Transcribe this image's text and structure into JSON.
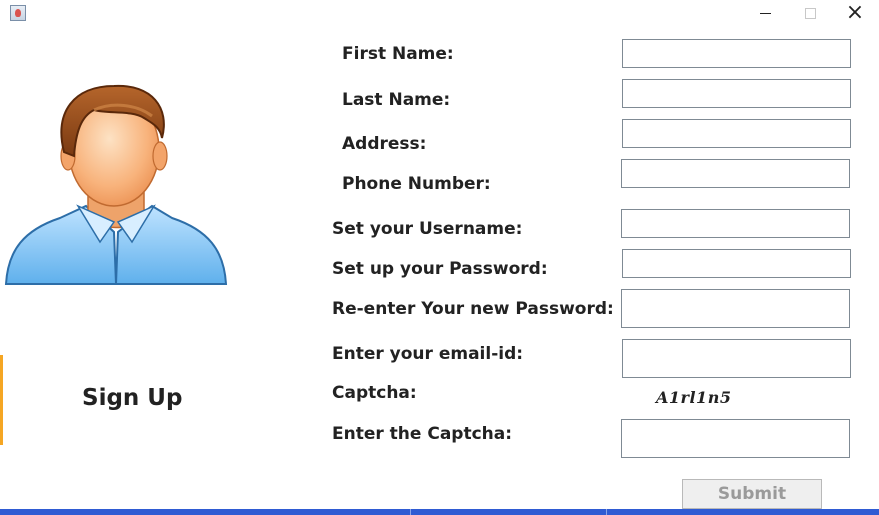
{
  "window": {
    "title_bar": {
      "icon": "java-app-icon",
      "minimize_glyph": "–",
      "maximize_glyph": "□",
      "close_glyph": "×"
    }
  },
  "avatar": {
    "icon": "user-avatar-icon"
  },
  "page_title": "Sign Up",
  "form": {
    "first_name": {
      "label": "First Name:",
      "value": ""
    },
    "last_name": {
      "label": "Last Name:",
      "value": ""
    },
    "address": {
      "label": "Address:",
      "value": ""
    },
    "phone_number": {
      "label": "Phone Number:",
      "value": ""
    },
    "username": {
      "label": "Set your Username:",
      "value": ""
    },
    "password": {
      "label": "Set up your Password:",
      "value": ""
    },
    "reenter_password": {
      "label": "Re-enter Your new Password:",
      "value": ""
    },
    "email": {
      "label": "Enter your email-id:",
      "value": ""
    },
    "captcha": {
      "label": "Captcha:",
      "value": "A1rl1n5"
    },
    "captcha_entry": {
      "label": "Enter the Captcha:",
      "value": ""
    },
    "submit_label": "Submit"
  },
  "colors": {
    "accent_bottom": "#2f5bd3",
    "accent_left": "#f5a623",
    "field_border": "#7f8a94",
    "submit_text": "#9a9a9a"
  }
}
